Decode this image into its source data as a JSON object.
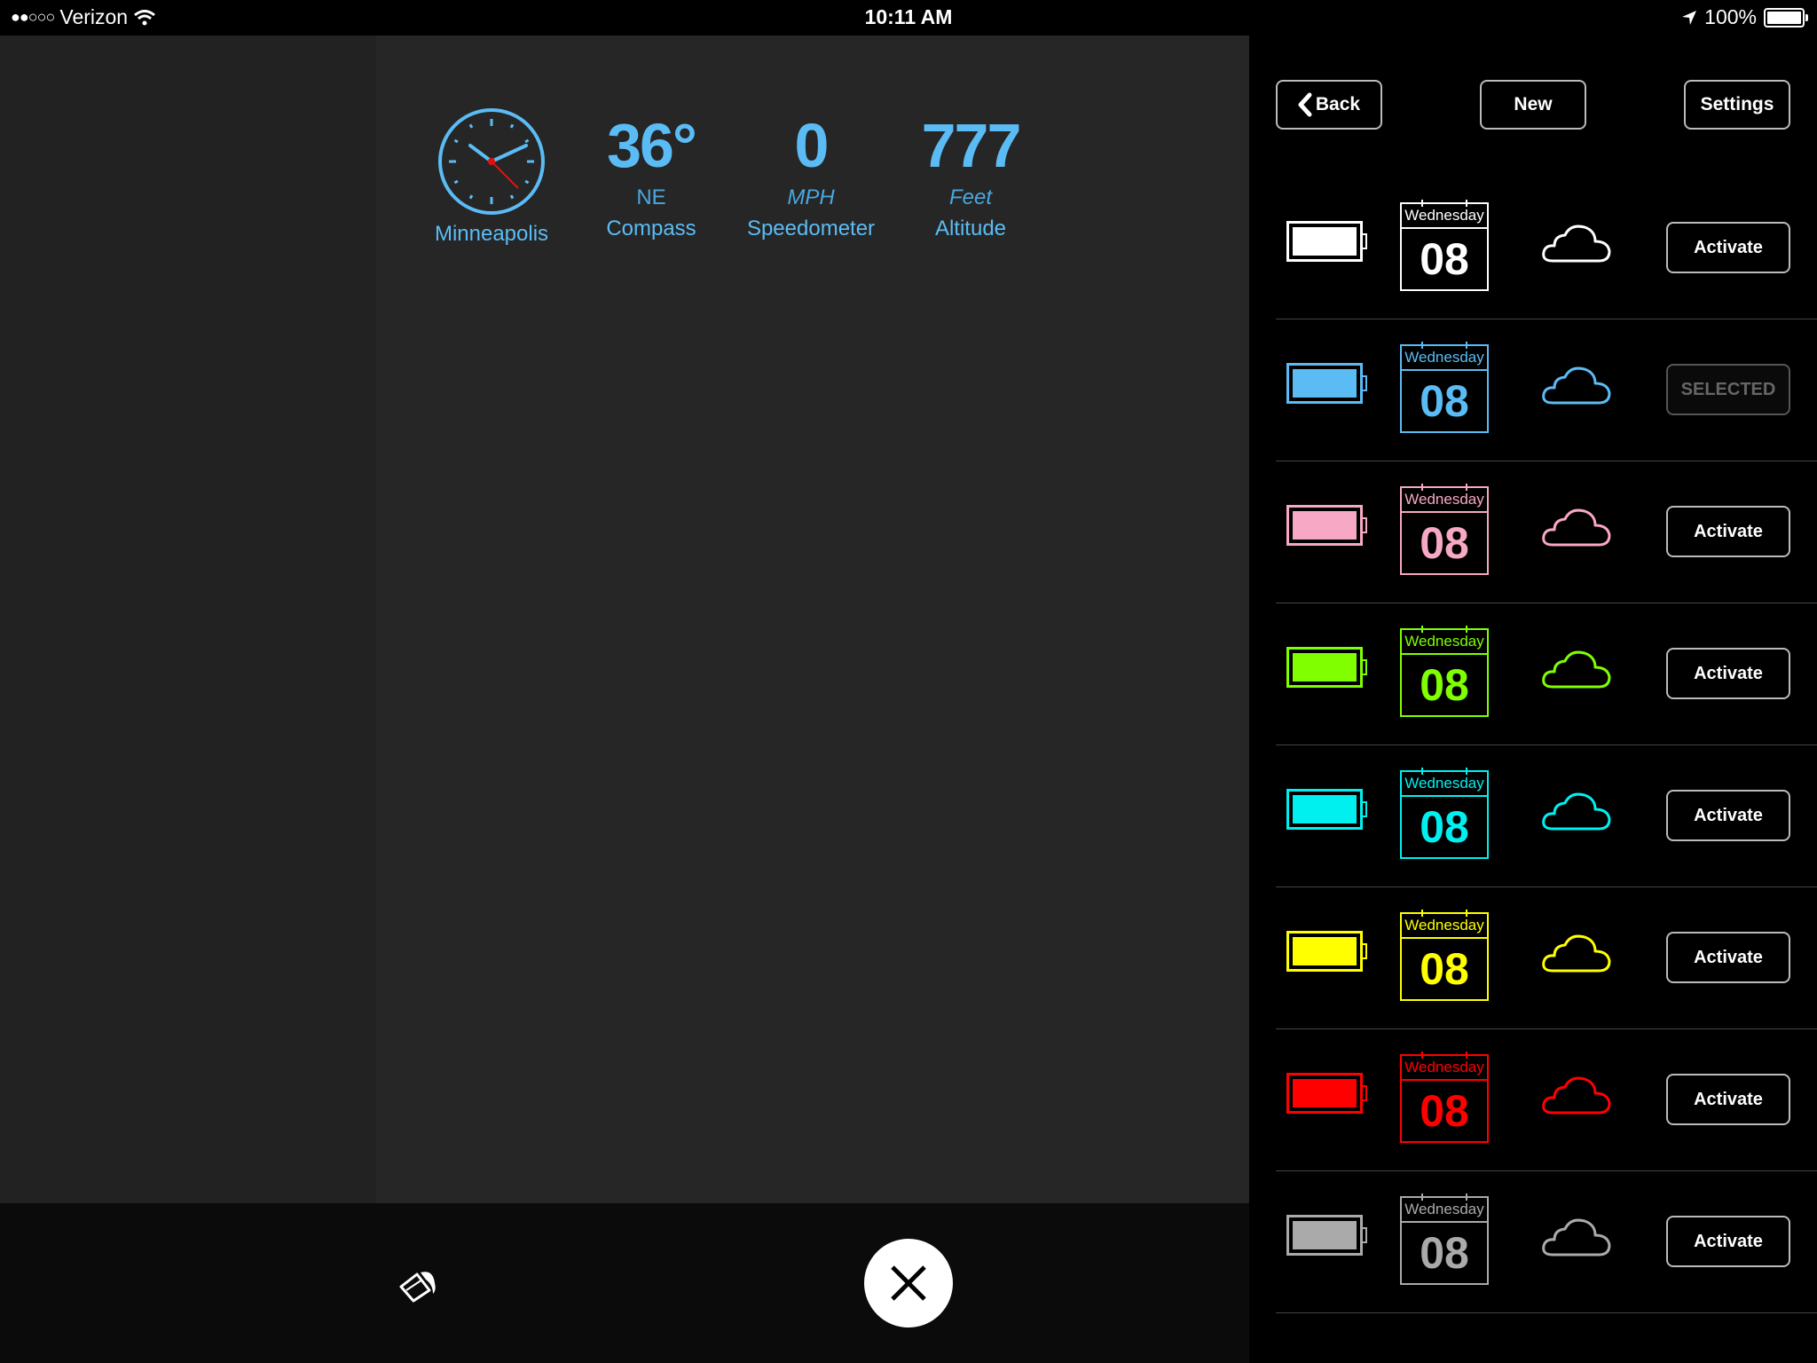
{
  "status": {
    "signal": "●●○○○",
    "carrier": "Verizon",
    "time": "10:11 AM",
    "battery": "100%",
    "battery_level": 1.0
  },
  "widgets": {
    "clock_city": "Minneapolis",
    "compass_value": "36°",
    "compass_dir": "NE",
    "compass_label": "Compass",
    "speed_value": "0",
    "speed_unit": "MPH",
    "speed_label": "Speedometer",
    "altitude_value": "777",
    "altitude_unit": "Feet",
    "altitude_label": "Altitude"
  },
  "toolbar": {
    "back_label": "Back",
    "new_label": "New",
    "settings_label": "Settings"
  },
  "themes": [
    {
      "color": "#ffffff",
      "day": "Wednesday",
      "date": "08",
      "button": "Activate",
      "selected": false
    },
    {
      "color": "#5bbcf5",
      "day": "Wednesday",
      "date": "08",
      "button": "SELECTED",
      "selected": true
    },
    {
      "color": "#f7a8c4",
      "day": "Wednesday",
      "date": "08",
      "button": "Activate",
      "selected": false
    },
    {
      "color": "#7fff00",
      "day": "Wednesday",
      "date": "08",
      "button": "Activate",
      "selected": false
    },
    {
      "color": "#00f0f0",
      "day": "Wednesday",
      "date": "08",
      "button": "Activate",
      "selected": false
    },
    {
      "color": "#ffff00",
      "day": "Wednesday",
      "date": "08",
      "button": "Activate",
      "selected": false
    },
    {
      "color": "#ff0000",
      "day": "Wednesday",
      "date": "08",
      "button": "Activate",
      "selected": false
    },
    {
      "color": "#aaaaaa",
      "day": "Wednesday",
      "date": "08",
      "button": "Activate",
      "selected": false
    }
  ],
  "icons": {
    "wifi": "wifi-icon",
    "location": "location-arrow-icon",
    "paint": "paint-bucket-icon",
    "close": "close-icon",
    "back": "chevron-left-icon",
    "cloud": "cloud-icon"
  }
}
